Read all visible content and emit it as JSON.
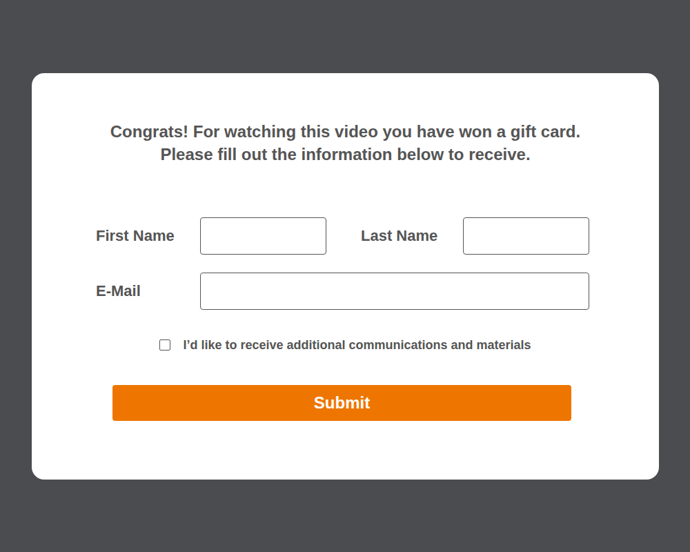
{
  "modal": {
    "heading": [
      "Congrats! For watching this video you have won a gift card.",
      "Please fill out the information below to receive."
    ],
    "fields": [
      {
        "label": "First Name"
      },
      {
        "label": "Last Name"
      },
      {
        "label": "E-Mail"
      }
    ],
    "consent": {
      "label": "I’d like to receive additional communications and materials",
      "checked": false
    },
    "submit": "Submit"
  }
}
